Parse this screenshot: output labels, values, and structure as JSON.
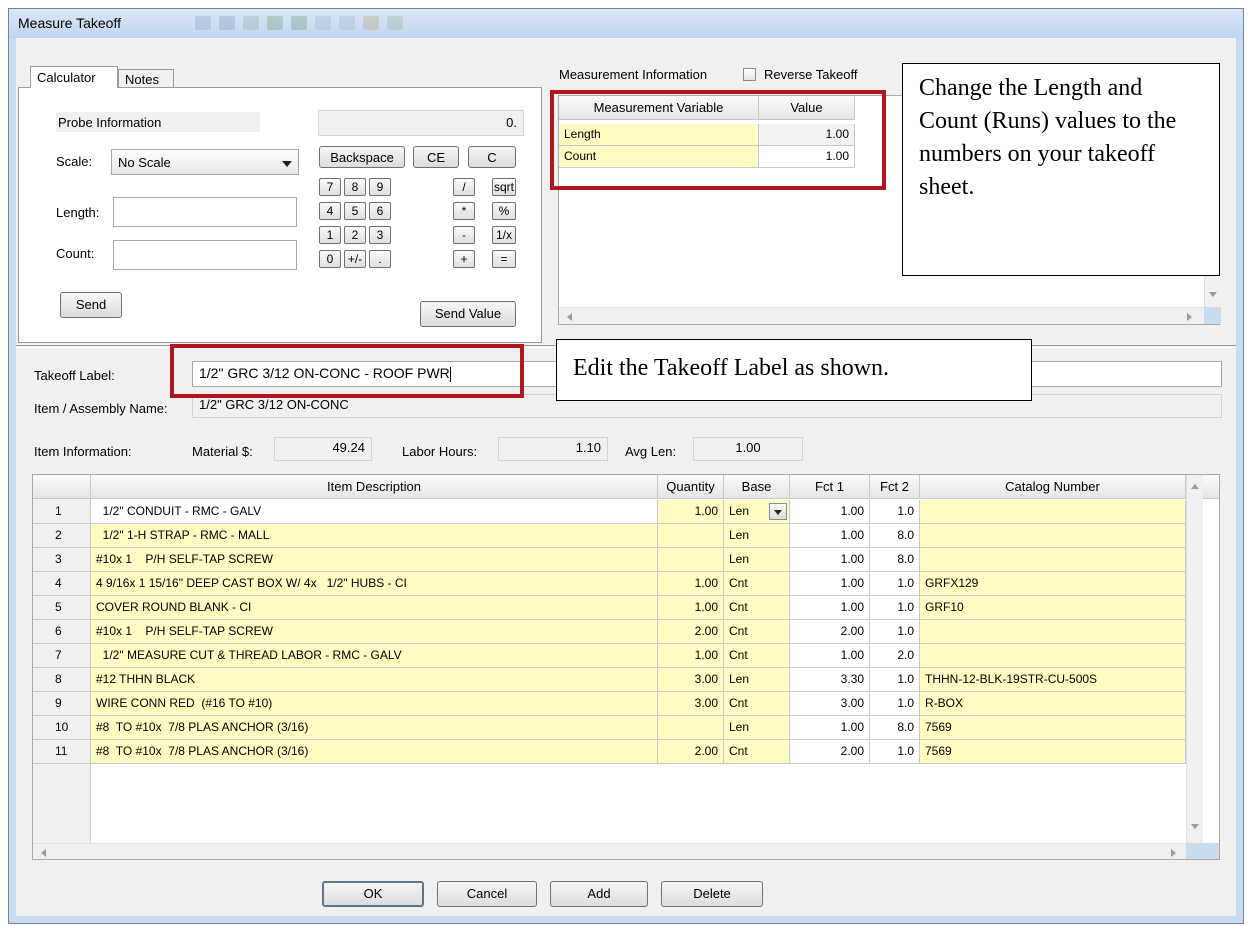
{
  "window": {
    "title": "Measure Takeoff"
  },
  "tabs": [
    {
      "label": "Calculator"
    },
    {
      "label": "Notes"
    }
  ],
  "calculator": {
    "probe_label": "Probe Information",
    "display": "0.",
    "scale_label": "Scale:",
    "scale_value": "No Scale",
    "length_label": "Length:",
    "length_value": "",
    "count_label": "Count:",
    "count_value": "",
    "send_label": "Send",
    "send_value_label": "Send Value",
    "backspace": "Backspace",
    "ce": "CE",
    "c": "C",
    "keys": [
      "7",
      "8",
      "9",
      "/",
      "sqrt",
      "4",
      "5",
      "6",
      "*",
      "%",
      "1",
      "2",
      "3",
      "-",
      "1/x",
      "0",
      "+/-",
      ".",
      "+",
      "="
    ]
  },
  "measurement": {
    "section_label": "Measurement Information",
    "reverse_label": "Reverse Takeoff",
    "reverse_checked": false,
    "col_variable": "Measurement Variable",
    "col_value": "Value",
    "rows": [
      {
        "name": "Length",
        "value": "1.00"
      },
      {
        "name": "Count",
        "value": "1.00"
      }
    ]
  },
  "takeoff": {
    "label": "Takeoff Label:",
    "value": "1/2\" GRC  3/12 ON-CONC - ROOF PWR",
    "item_label": "Item / Assembly Name:",
    "item_value": "1/2\" GRC  3/12 ON-CONC"
  },
  "item_info": {
    "label": "Item Information:",
    "material_label": "Material $:",
    "material_value": "49.24",
    "labor_label": "Labor Hours:",
    "labor_value": "1.10",
    "avglen_label": "Avg Len:",
    "avglen_value": "1.00"
  },
  "grid": {
    "columns": [
      "Item Description",
      "Quantity",
      "Base",
      "Fct 1",
      "Fct 2",
      "Catalog Number"
    ],
    "rows": [
      {
        "n": "1",
        "desc": "  1/2\" CONDUIT - RMC - GALV",
        "qty": "1.00",
        "base": "Len",
        "f1": "1.00",
        "f2": "1.0",
        "cat": ""
      },
      {
        "n": "2",
        "desc": "  1/2\" 1-H STRAP - RMC - MALL",
        "qty": "",
        "base": "Len",
        "f1": "1.00",
        "f2": "8.0",
        "cat": ""
      },
      {
        "n": "3",
        "desc": "#10x 1    P/H SELF-TAP SCREW",
        "qty": "",
        "base": "Len",
        "f1": "1.00",
        "f2": "8.0",
        "cat": ""
      },
      {
        "n": "4",
        "desc": "4 9/16x 1 15/16\" DEEP CAST BOX W/ 4x   1/2\" HUBS - CI",
        "qty": "1.00",
        "base": "Cnt",
        "f1": "1.00",
        "f2": "1.0",
        "cat": "GRFX129"
      },
      {
        "n": "5",
        "desc": "COVER ROUND BLANK - CI",
        "qty": "1.00",
        "base": "Cnt",
        "f1": "1.00",
        "f2": "1.0",
        "cat": "GRF10"
      },
      {
        "n": "6",
        "desc": "#10x 1    P/H SELF-TAP SCREW",
        "qty": "2.00",
        "base": "Cnt",
        "f1": "2.00",
        "f2": "1.0",
        "cat": ""
      },
      {
        "n": "7",
        "desc": "  1/2\" MEASURE CUT & THREAD LABOR - RMC - GALV",
        "qty": "1.00",
        "base": "Cnt",
        "f1": "1.00",
        "f2": "2.0",
        "cat": ""
      },
      {
        "n": "8",
        "desc": "#12 THHN BLACK",
        "qty": "3.00",
        "base": "Len",
        "f1": "3.30",
        "f2": "1.0",
        "cat": "THHN-12-BLK-19STR-CU-500S"
      },
      {
        "n": "9",
        "desc": "WIRE CONN RED  (#16 TO #10)",
        "qty": "3.00",
        "base": "Cnt",
        "f1": "3.00",
        "f2": "1.0",
        "cat": "R-BOX"
      },
      {
        "n": "10",
        "desc": "#8  TO #10x  7/8 PLAS ANCHOR (3/16)",
        "qty": "",
        "base": "Len",
        "f1": "1.00",
        "f2": "8.0",
        "cat": "7569"
      },
      {
        "n": "11",
        "desc": "#8  TO #10x  7/8 PLAS ANCHOR (3/16)",
        "qty": "2.00",
        "base": "Cnt",
        "f1": "2.00",
        "f2": "1.0",
        "cat": "7569"
      }
    ]
  },
  "buttons": {
    "ok": "OK",
    "cancel": "Cancel",
    "add": "Add",
    "delete": "Delete"
  },
  "callouts": {
    "top": "Change the Length and Count (Runs) values to the numbers on your takeoff sheet.",
    "label": "Edit the Takeoff Label as shown."
  },
  "colors": {
    "highlight": "#fffbc2",
    "annotation_red": "#b0161d"
  }
}
